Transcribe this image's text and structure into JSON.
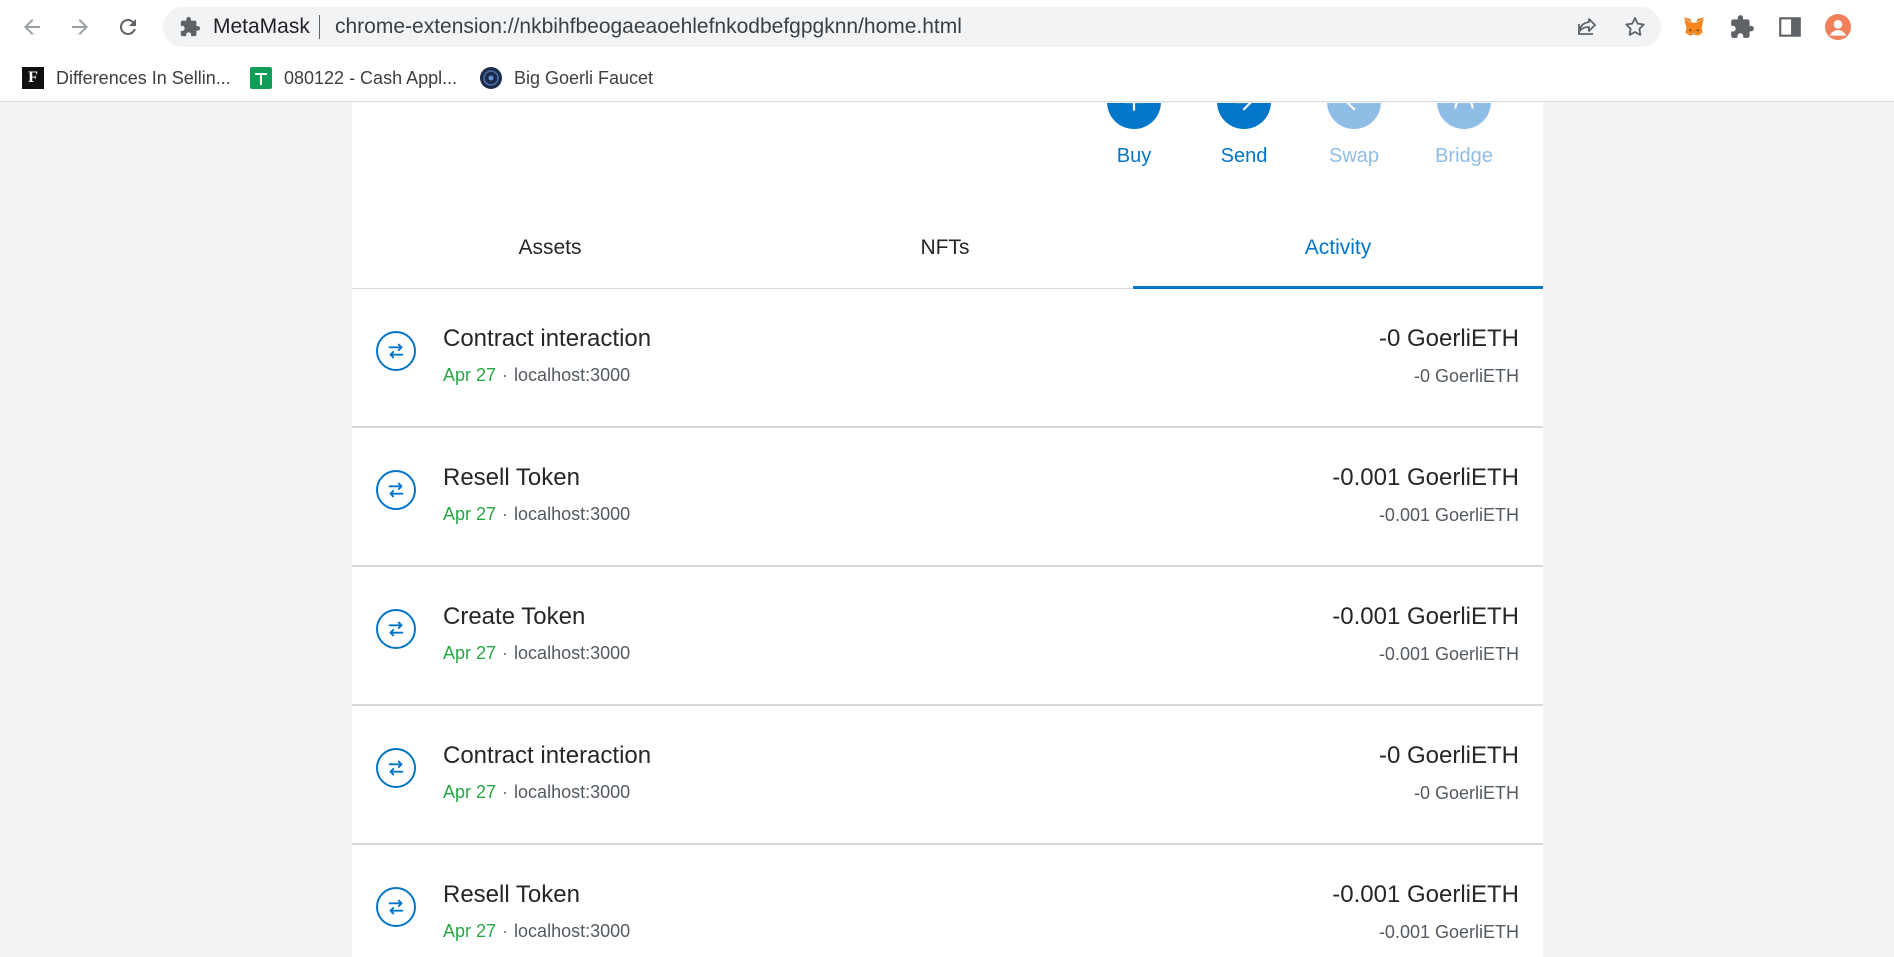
{
  "browser": {
    "site_name": "MetaMask",
    "url": "chrome-extension://nkbihfbeogaeaoehlefnkodbefgpgknn/home.html"
  },
  "bookmarks": [
    {
      "icon_text": "F",
      "label": "Differences In Sellin..."
    },
    {
      "icon_text": "",
      "label": "080122 - Cash Appl..."
    },
    {
      "icon_text": "",
      "label": "Big Goerli Faucet"
    }
  ],
  "actions": [
    {
      "label": "Buy"
    },
    {
      "label": "Send"
    },
    {
      "label": "Swap"
    },
    {
      "label": "Bridge"
    }
  ],
  "tabs": [
    {
      "label": "Assets"
    },
    {
      "label": "NFTs"
    },
    {
      "label": "Activity"
    }
  ],
  "transactions": [
    {
      "title": "Contract interaction",
      "date": "Apr 27",
      "separator": "·",
      "origin": "localhost:3000",
      "amount": "-0 GoerliETH",
      "amount_secondary": "-0 GoerliETH"
    },
    {
      "title": "Resell Token",
      "date": "Apr 27",
      "separator": "·",
      "origin": "localhost:3000",
      "amount": "-0.001 GoerliETH",
      "amount_secondary": "-0.001 GoerliETH"
    },
    {
      "title": "Create Token",
      "date": "Apr 27",
      "separator": "·",
      "origin": "localhost:3000",
      "amount": "-0.001 GoerliETH",
      "amount_secondary": "-0.001 GoerliETH"
    },
    {
      "title": "Contract interaction",
      "date": "Apr 27",
      "separator": "·",
      "origin": "localhost:3000",
      "amount": "-0 GoerliETH",
      "amount_secondary": "-0 GoerliETH"
    },
    {
      "title": "Resell Token",
      "date": "Apr 27",
      "separator": "·",
      "origin": "localhost:3000",
      "amount": "-0.001 GoerliETH",
      "amount_secondary": "-0.001 GoerliETH"
    }
  ],
  "colors": {
    "primary": "#0376c9",
    "primary_disabled": "#8fbde6",
    "date_green": "#28a745"
  },
  "icons": {
    "back": "arrow-left-icon",
    "forward": "arrow-right-icon",
    "reload": "reload-icon",
    "extension": "puzzle-icon",
    "share": "share-icon",
    "bookmark": "star-icon",
    "metamask": "fox-icon",
    "sidepanel": "side-panel-icon",
    "profile": "avatar-icon",
    "transaction": "swap-arrows-icon"
  }
}
